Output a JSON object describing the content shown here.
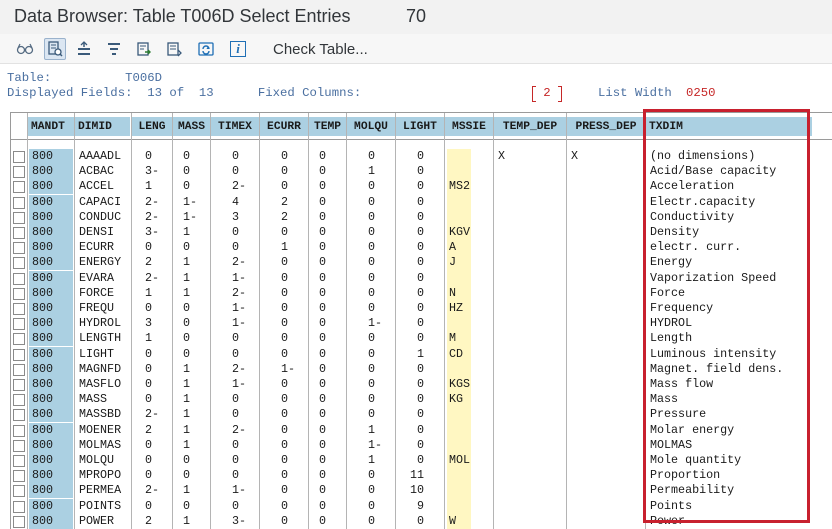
{
  "window": {
    "title": "Data Browser: Table T006D Select Entries",
    "count": "70"
  },
  "toolbar": {
    "icons": [
      {
        "name": "glasses-icon",
        "glyph": "ꝏ"
      },
      {
        "name": "refresh-select-icon",
        "glyph": "⟳"
      },
      {
        "name": "sort-ascending-icon",
        "glyph": "≜"
      },
      {
        "name": "filter-icon",
        "glyph": "⏷"
      },
      {
        "name": "export-icon",
        "glyph": "⇲"
      },
      {
        "name": "choose-layout-icon",
        "glyph": "⇱"
      },
      {
        "name": "sync-icon",
        "glyph": "⟲"
      },
      {
        "name": "info-icon",
        "glyph": "i"
      }
    ],
    "check_table_label": "Check Table..."
  },
  "info": {
    "line1": "Table:          T006D",
    "line2": "Displayed Fields:  13 of  13      Fixed Columns:",
    "fixed_columns_value": "2",
    "list_width_label": "List Width",
    "list_width_value": "0250"
  },
  "columns": [
    "MANDT",
    "DIMID",
    "LENG",
    "MASS",
    "TIMEX",
    "ECURR",
    "TEMP",
    "MOLQU",
    "LIGHT",
    "MSSIE",
    "TEMP_DEP",
    "PRESS_DEP",
    "TXDIM"
  ],
  "rows": [
    [
      "800",
      "AAAADL",
      "0",
      "0",
      "0",
      "0",
      "0",
      "0",
      "0",
      "",
      "X",
      "X",
      "(no dimensions)"
    ],
    [
      "800",
      "ACBAC",
      "3-",
      "0",
      "0",
      "0",
      "0",
      "1",
      "0",
      "",
      "",
      "",
      "Acid/Base capacity"
    ],
    [
      "800",
      "ACCEL",
      "1",
      "0",
      "2-",
      "0",
      "0",
      "0",
      "0",
      "MS2",
      "",
      "",
      "Acceleration"
    ],
    [
      "800",
      "CAPACI",
      "2-",
      "1-",
      "4",
      "2",
      "0",
      "0",
      "0",
      "",
      "",
      "",
      "Electr.capacity"
    ],
    [
      "800",
      "CONDUC",
      "2-",
      "1-",
      "3",
      "2",
      "0",
      "0",
      "0",
      "",
      "",
      "",
      "Conductivity"
    ],
    [
      "800",
      "DENSI",
      "3-",
      "1",
      "0",
      "0",
      "0",
      "0",
      "0",
      "KGV",
      "",
      "",
      "Density"
    ],
    [
      "800",
      "ECURR",
      "0",
      "0",
      "0",
      "1",
      "0",
      "0",
      "0",
      "A",
      "",
      "",
      "electr. curr."
    ],
    [
      "800",
      "ENERGY",
      "2",
      "1",
      "2-",
      "0",
      "0",
      "0",
      "0",
      "J",
      "",
      "",
      "Energy"
    ],
    [
      "800",
      "EVARA",
      "2-",
      "1",
      "1-",
      "0",
      "0",
      "0",
      "0",
      "",
      "",
      "",
      "Vaporization Speed"
    ],
    [
      "800",
      "FORCE",
      "1",
      "1",
      "2-",
      "0",
      "0",
      "0",
      "0",
      "N",
      "",
      "",
      "Force"
    ],
    [
      "800",
      "FREQU",
      "0",
      "0",
      "1-",
      "0",
      "0",
      "0",
      "0",
      "HZ",
      "",
      "",
      "Frequency"
    ],
    [
      "800",
      "HYDROL",
      "3",
      "0",
      "1-",
      "0",
      "0",
      "1-",
      "0",
      "",
      "",
      "",
      "HYDROL"
    ],
    [
      "800",
      "LENGTH",
      "1",
      "0",
      "0",
      "0",
      "0",
      "0",
      "0",
      "M",
      "",
      "",
      "Length"
    ],
    [
      "800",
      "LIGHT",
      "0",
      "0",
      "0",
      "0",
      "0",
      "0",
      "1",
      "CD",
      "",
      "",
      "Luminous intensity"
    ],
    [
      "800",
      "MAGNFD",
      "0",
      "1",
      "2-",
      "1-",
      "0",
      "0",
      "0",
      "",
      "",
      "",
      "Magnet. field dens."
    ],
    [
      "800",
      "MASFLO",
      "0",
      "1",
      "1-",
      "0",
      "0",
      "0",
      "0",
      "KGS",
      "",
      "",
      "Mass flow"
    ],
    [
      "800",
      "MASS",
      "0",
      "1",
      "0",
      "0",
      "0",
      "0",
      "0",
      "KG",
      "",
      "",
      "Mass"
    ],
    [
      "800",
      "MASSBD",
      "2-",
      "1",
      "0",
      "0",
      "0",
      "0",
      "0",
      "",
      "",
      "",
      "Pressure"
    ],
    [
      "800",
      "MOENER",
      "2",
      "1",
      "2-",
      "0",
      "0",
      "1",
      "0",
      "",
      "",
      "",
      "Molar energy"
    ],
    [
      "800",
      "MOLMAS",
      "0",
      "1",
      "0",
      "0",
      "0",
      "1-",
      "0",
      "",
      "",
      "",
      "MOLMAS"
    ],
    [
      "800",
      "MOLQU",
      "0",
      "0",
      "0",
      "0",
      "0",
      "1",
      "0",
      "MOL",
      "",
      "",
      "Mole quantity"
    ],
    [
      "800",
      "MPROPO",
      "0",
      "0",
      "0",
      "0",
      "0",
      "0",
      "11",
      "",
      "",
      "",
      "Proportion"
    ],
    [
      "800",
      "PERMEA",
      "2-",
      "1",
      "1-",
      "0",
      "0",
      "0",
      "10",
      "",
      "",
      "",
      "Permeability"
    ],
    [
      "800",
      "POINTS",
      "0",
      "0",
      "0",
      "0",
      "0",
      "0",
      "9",
      "",
      "",
      "",
      "Points"
    ],
    [
      "800",
      "POWER",
      "2",
      "1",
      "3-",
      "0",
      "0",
      "0",
      "0",
      "W",
      "",
      "",
      "Power"
    ]
  ]
}
